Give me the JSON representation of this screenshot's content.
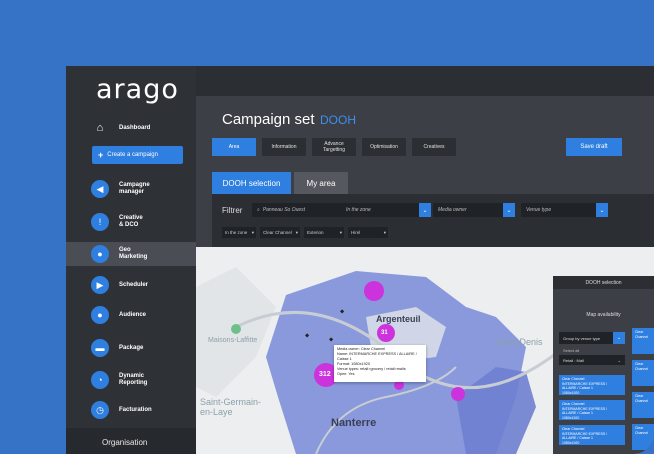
{
  "app": {
    "logo": "arago"
  },
  "sidebar": {
    "dashboard": "Dashboard",
    "create": "Create a campaign",
    "items": [
      {
        "label": "Campagne\nmanager",
        "icon": "megaphone-icon"
      },
      {
        "label": "Creative\n& DCO",
        "icon": "lightbulb-icon"
      },
      {
        "label": "Geo\nMarketing",
        "icon": "map-pin-icon"
      },
      {
        "label": "Scheduler",
        "icon": "scheduler-icon"
      },
      {
        "label": "Audience",
        "icon": "audience-icon"
      },
      {
        "label": "Package",
        "icon": "package-icon"
      },
      {
        "label": "Dynamic\nReporting",
        "icon": "reporting-icon"
      },
      {
        "label": "Facturation",
        "icon": "clock-icon"
      }
    ],
    "organisation": "Organisation"
  },
  "header": {
    "title": "Campaign set",
    "subtitle": "DOOH"
  },
  "steps": [
    "Area",
    "Information",
    "Advance\nTargetting",
    "Optimisation",
    "Creatives"
  ],
  "save_label": "Save draft",
  "selection_tabs": [
    "DOOH selection",
    "My area"
  ],
  "filter": {
    "label": "Filtrer",
    "search_value": "Panneau So Ouest",
    "zone": "In the zone",
    "owner": "Media owner",
    "venue": "Venue type",
    "chips": [
      "In the zone",
      "Clear Channel",
      "Exterion",
      "Hirel"
    ]
  },
  "map": {
    "labels": [
      "Argenteuil",
      "Saint-Denis",
      "Maisons-Laffitte",
      "Saint-Germain-en-Laye",
      "Nanterre"
    ],
    "cluster_count": "312",
    "cluster_count_2": "31",
    "popup": [
      "Media owner: Clear Channel",
      "Name: INTERMARCHE EXPRESS / ALLAIRE / Caisse 1",
      "Format: 1080x1920",
      "Venue types: retail>grocery / retail>malls",
      "Open: Yes"
    ]
  },
  "panel": {
    "title": "DOOH selection",
    "availability": "Map availability",
    "group": "Group by venue type",
    "select_all": "Select all",
    "retail": "Retail : Mall",
    "cards": [
      "Clear Channel\nINTERMARCHE EXPRESS / ALLAIRE / Caisse 1\n1080x1920",
      "Clear Channel\nINTERMARCHE EXPRESS / ALLAIRE / Caisse 1\n1080x1920",
      "Clear Channel\nINTERMARCHE EXPRESS / ALLAIRE / Caisse 1\n1080x1920"
    ],
    "right_cards": [
      "Clear Channel",
      "Clear Channel",
      "Clear Channel",
      "Clear Channel"
    ]
  },
  "colors": {
    "accent": "#2e7fe0",
    "zone": "#7e8fd8",
    "marker": "#cc33dd"
  }
}
